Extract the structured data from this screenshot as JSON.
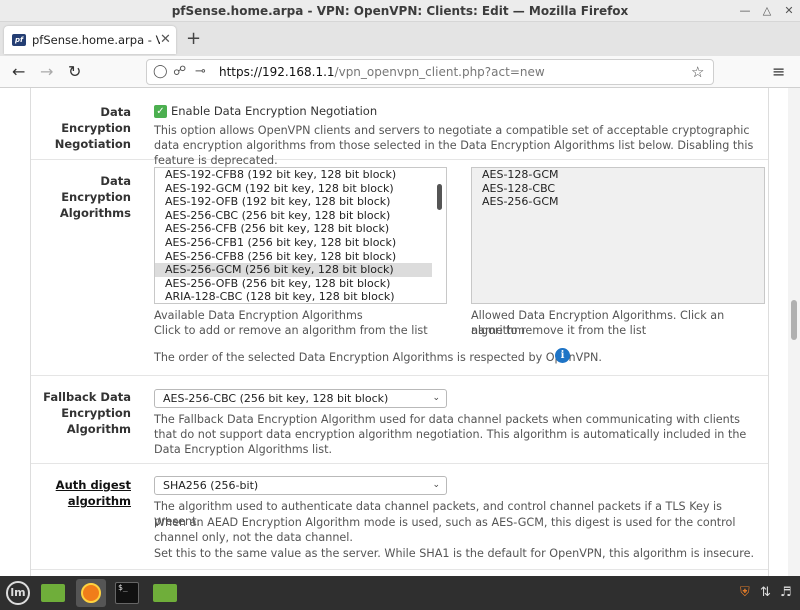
{
  "window": {
    "title": "pfSense.home.arpa - VPN: OpenVPN: Clients: Edit — Mozilla Firefox"
  },
  "tab": {
    "favicon_text": "pf",
    "title": "pfSense.home.arpa - VPN: O"
  },
  "navbar": {
    "url_host": "https://192.168.1.1",
    "url_path": "/vpn_openvpn_client.php?act=new"
  },
  "data_negotiation": {
    "label": "Data Encryption Negotiation",
    "checkbox_label": "Enable Data Encryption Negotiation",
    "checked": true,
    "help": "This option allows OpenVPN clients and servers to negotiate a compatible set of acceptable cryptographic data encryption algorithms from those selected in the Data Encryption Algorithms list below. Disabling this feature is deprecated."
  },
  "data_algorithms": {
    "label": "Data Encryption Algorithms",
    "available": [
      "AES-192-CFB8 (192 bit key, 128 bit block)",
      "AES-192-GCM (192 bit key, 128 bit block)",
      "AES-192-OFB (192 bit key, 128 bit block)",
      "AES-256-CBC (256 bit key, 128 bit block)",
      "AES-256-CFB (256 bit key, 128 bit block)",
      "AES-256-CFB1 (256 bit key, 128 bit block)",
      "AES-256-CFB8 (256 bit key, 128 bit block)",
      "AES-256-GCM (256 bit key, 128 bit block)",
      "AES-256-OFB (256 bit key, 128 bit block)",
      "ARIA-128-CBC (128 bit key, 128 bit block)"
    ],
    "available_selected": "AES-256-GCM (256 bit key, 128 bit block)",
    "allowed": [
      "AES-128-GCM",
      "AES-128-CBC",
      "AES-256-GCM"
    ],
    "available_help_1": "Available Data Encryption Algorithms",
    "available_help_2": "Click to add or remove an algorithm from the list",
    "allowed_help_1": "Allowed Data Encryption Algorithms. Click an algorithm",
    "allowed_help_2": "name to remove it from the list",
    "order_note": "The order of the selected Data Encryption Algorithms is respected by OpenVPN.",
    "info_glyph": "i"
  },
  "fallback": {
    "label": "Fallback Data Encryption Algorithm",
    "value": "AES-256-CBC (256 bit key, 128 bit block)",
    "help": "The Fallback Data Encryption Algorithm used for data channel packets when communicating with clients that do not support data encryption algorithm negotiation. This algorithm is automatically included in the Data Encryption Algorithms list."
  },
  "auth_digest": {
    "label": "Auth digest algorithm",
    "value": "SHA256 (256-bit)",
    "help_1": "The algorithm used to authenticate data channel packets, and control channel packets if a TLS Key is present.",
    "help_2": "When an AEAD Encryption Algorithm mode is used, such as AES-GCM, this digest is used for the control channel only, not the data channel.",
    "help_3": "Set this to the same value as the server. While SHA1 is the default for OpenVPN, this algorithm is insecure."
  },
  "taskbar": {
    "mint_text": "lm",
    "terminal_text": "$_"
  },
  "colors": {
    "checkbox": "#4caf50",
    "info": "#1e74c6",
    "taskbar": "#2f2f2f"
  }
}
